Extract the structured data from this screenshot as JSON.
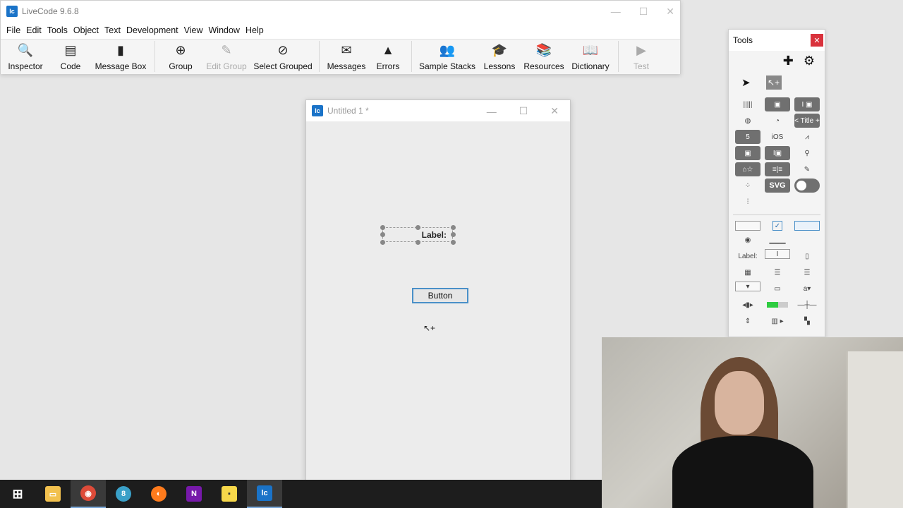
{
  "main_window": {
    "title": "LiveCode 9.6.8",
    "menu": [
      "File",
      "Edit",
      "Tools",
      "Object",
      "Text",
      "Development",
      "View",
      "Window",
      "Help"
    ],
    "toolbar": [
      {
        "label": "Inspector",
        "icon": "inspector-icon",
        "glyph": "🔍",
        "disabled": false
      },
      {
        "label": "Code",
        "icon": "code-icon",
        "glyph": "▤",
        "disabled": false
      },
      {
        "label": "Message Box",
        "icon": "message-box-icon",
        "glyph": "▮",
        "disabled": false
      },
      {
        "label": "Group",
        "icon": "group-icon",
        "glyph": "⊕",
        "disabled": false
      },
      {
        "label": "Edit Group",
        "icon": "edit-group-icon",
        "glyph": "✎",
        "disabled": true
      },
      {
        "label": "Select Grouped",
        "icon": "select-grouped-icon",
        "glyph": "⊘",
        "disabled": false
      },
      {
        "label": "Messages",
        "icon": "messages-icon",
        "glyph": "✉",
        "disabled": false
      },
      {
        "label": "Errors",
        "icon": "errors-icon",
        "glyph": "▲",
        "disabled": false
      },
      {
        "label": "Sample Stacks",
        "icon": "sample-stacks-icon",
        "glyph": "👥",
        "disabled": false
      },
      {
        "label": "Lessons",
        "icon": "lessons-icon",
        "glyph": "🎓",
        "disabled": false
      },
      {
        "label": "Resources",
        "icon": "resources-icon",
        "glyph": "📚",
        "disabled": false
      },
      {
        "label": "Dictionary",
        "icon": "dictionary-icon",
        "glyph": "📖",
        "disabled": false
      },
      {
        "label": "Test",
        "icon": "test-icon",
        "glyph": "▶",
        "disabled": true
      }
    ]
  },
  "stack_window": {
    "title": "Untitled 1 *",
    "label_field": "Label:",
    "button": "Button"
  },
  "tools_palette": {
    "title": "Tools",
    "label_tool": "Label:",
    "title_widget": "< Title +",
    "svg_widget": "SVG",
    "ios_widget": "iOS"
  },
  "taskbar": {
    "items": [
      {
        "icon": "windows-start-icon",
        "color": "#ffffff",
        "glyph": "⊞"
      },
      {
        "icon": "file-explorer-icon",
        "color": "#f2c14e",
        "glyph": "▭"
      },
      {
        "icon": "chrome-icon",
        "color": "#dd4b39",
        "glyph": "◉"
      },
      {
        "icon": "app-8-icon",
        "color": "#3aa0c8",
        "glyph": "8"
      },
      {
        "icon": "firefox-icon",
        "color": "#ff7b1c",
        "glyph": "◐"
      },
      {
        "icon": "onenote-icon",
        "color": "#7719aa",
        "glyph": "N"
      },
      {
        "icon": "sticky-notes-icon",
        "color": "#f7d84a",
        "glyph": "▪"
      },
      {
        "icon": "livecode-icon",
        "color": "#1a73c8",
        "glyph": "lc"
      }
    ]
  }
}
